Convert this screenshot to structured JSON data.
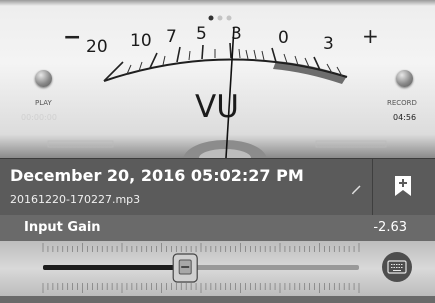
{
  "meter": {
    "scale_labels": [
      "20",
      "10",
      "7",
      "5",
      "3",
      "0",
      "3"
    ],
    "minus_sign": "−",
    "plus_sign": "+",
    "unit": "VU",
    "page_dots_count": 3,
    "page_dots_active": 0,
    "play_label": "PLAY",
    "play_time": "00:00:00",
    "record_label": "RECORD",
    "record_time": "04:56"
  },
  "recording": {
    "title": "December 20, 2016 05:02:27 PM",
    "filename": "20161220-170227.mp3"
  },
  "gain": {
    "label": "Input Gain",
    "value": "-2.63",
    "slider_level": 0.45
  },
  "icons": {
    "edit": "pencil-icon",
    "bookmark": "bookmark-plus-icon",
    "keyboard": "keyboard-icon"
  },
  "colors": {
    "info_bg": "#5b5b5b",
    "gain_bar_bg": "#6a6a6a",
    "red_zone": "#6d6d6d"
  }
}
